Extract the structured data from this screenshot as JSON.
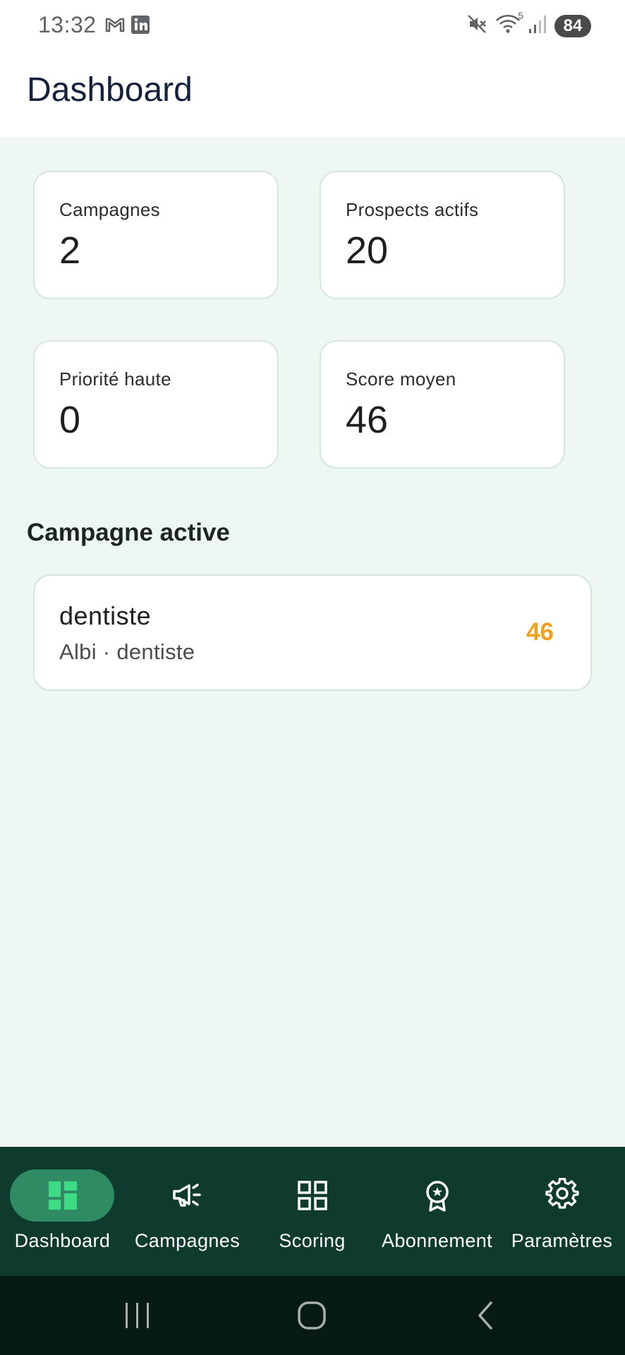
{
  "status_bar": {
    "time": "13:32",
    "left_icons": [
      "gmail-icon",
      "linkedin-icon"
    ],
    "right_icons": [
      "mute-icon",
      "wifi-icon",
      "signal-icon"
    ],
    "wifi_label": "5",
    "battery": "84"
  },
  "header": {
    "title": "Dashboard"
  },
  "stats": [
    {
      "label": "Campagnes",
      "value": "2"
    },
    {
      "label": "Prospects actifs",
      "value": "20"
    },
    {
      "label": "Priorité haute",
      "value": "0"
    },
    {
      "label": "Score moyen",
      "value": "46"
    }
  ],
  "section": {
    "title": "Campagne active"
  },
  "campaign": {
    "name": "dentiste",
    "subtitle": "Albi · dentiste",
    "score": "46",
    "score_color": "#f0a21b"
  },
  "bottom_nav": {
    "items": [
      {
        "label": "Dashboard",
        "icon": "dashboard-icon",
        "active": true
      },
      {
        "label": "Campagnes",
        "icon": "megaphone-icon",
        "active": false
      },
      {
        "label": "Scoring",
        "icon": "grid-icon",
        "active": false
      },
      {
        "label": "Abonnement",
        "icon": "award-icon",
        "active": false
      },
      {
        "label": "Paramètres",
        "icon": "gear-icon",
        "active": false
      }
    ]
  },
  "system_nav": [
    "recents-icon",
    "home-icon",
    "back-icon"
  ],
  "colors": {
    "accent": "#2e8b63",
    "nav_background": "#0e3b2e",
    "content_background": "#eff7f3",
    "active_icon": "#3ddc84"
  }
}
